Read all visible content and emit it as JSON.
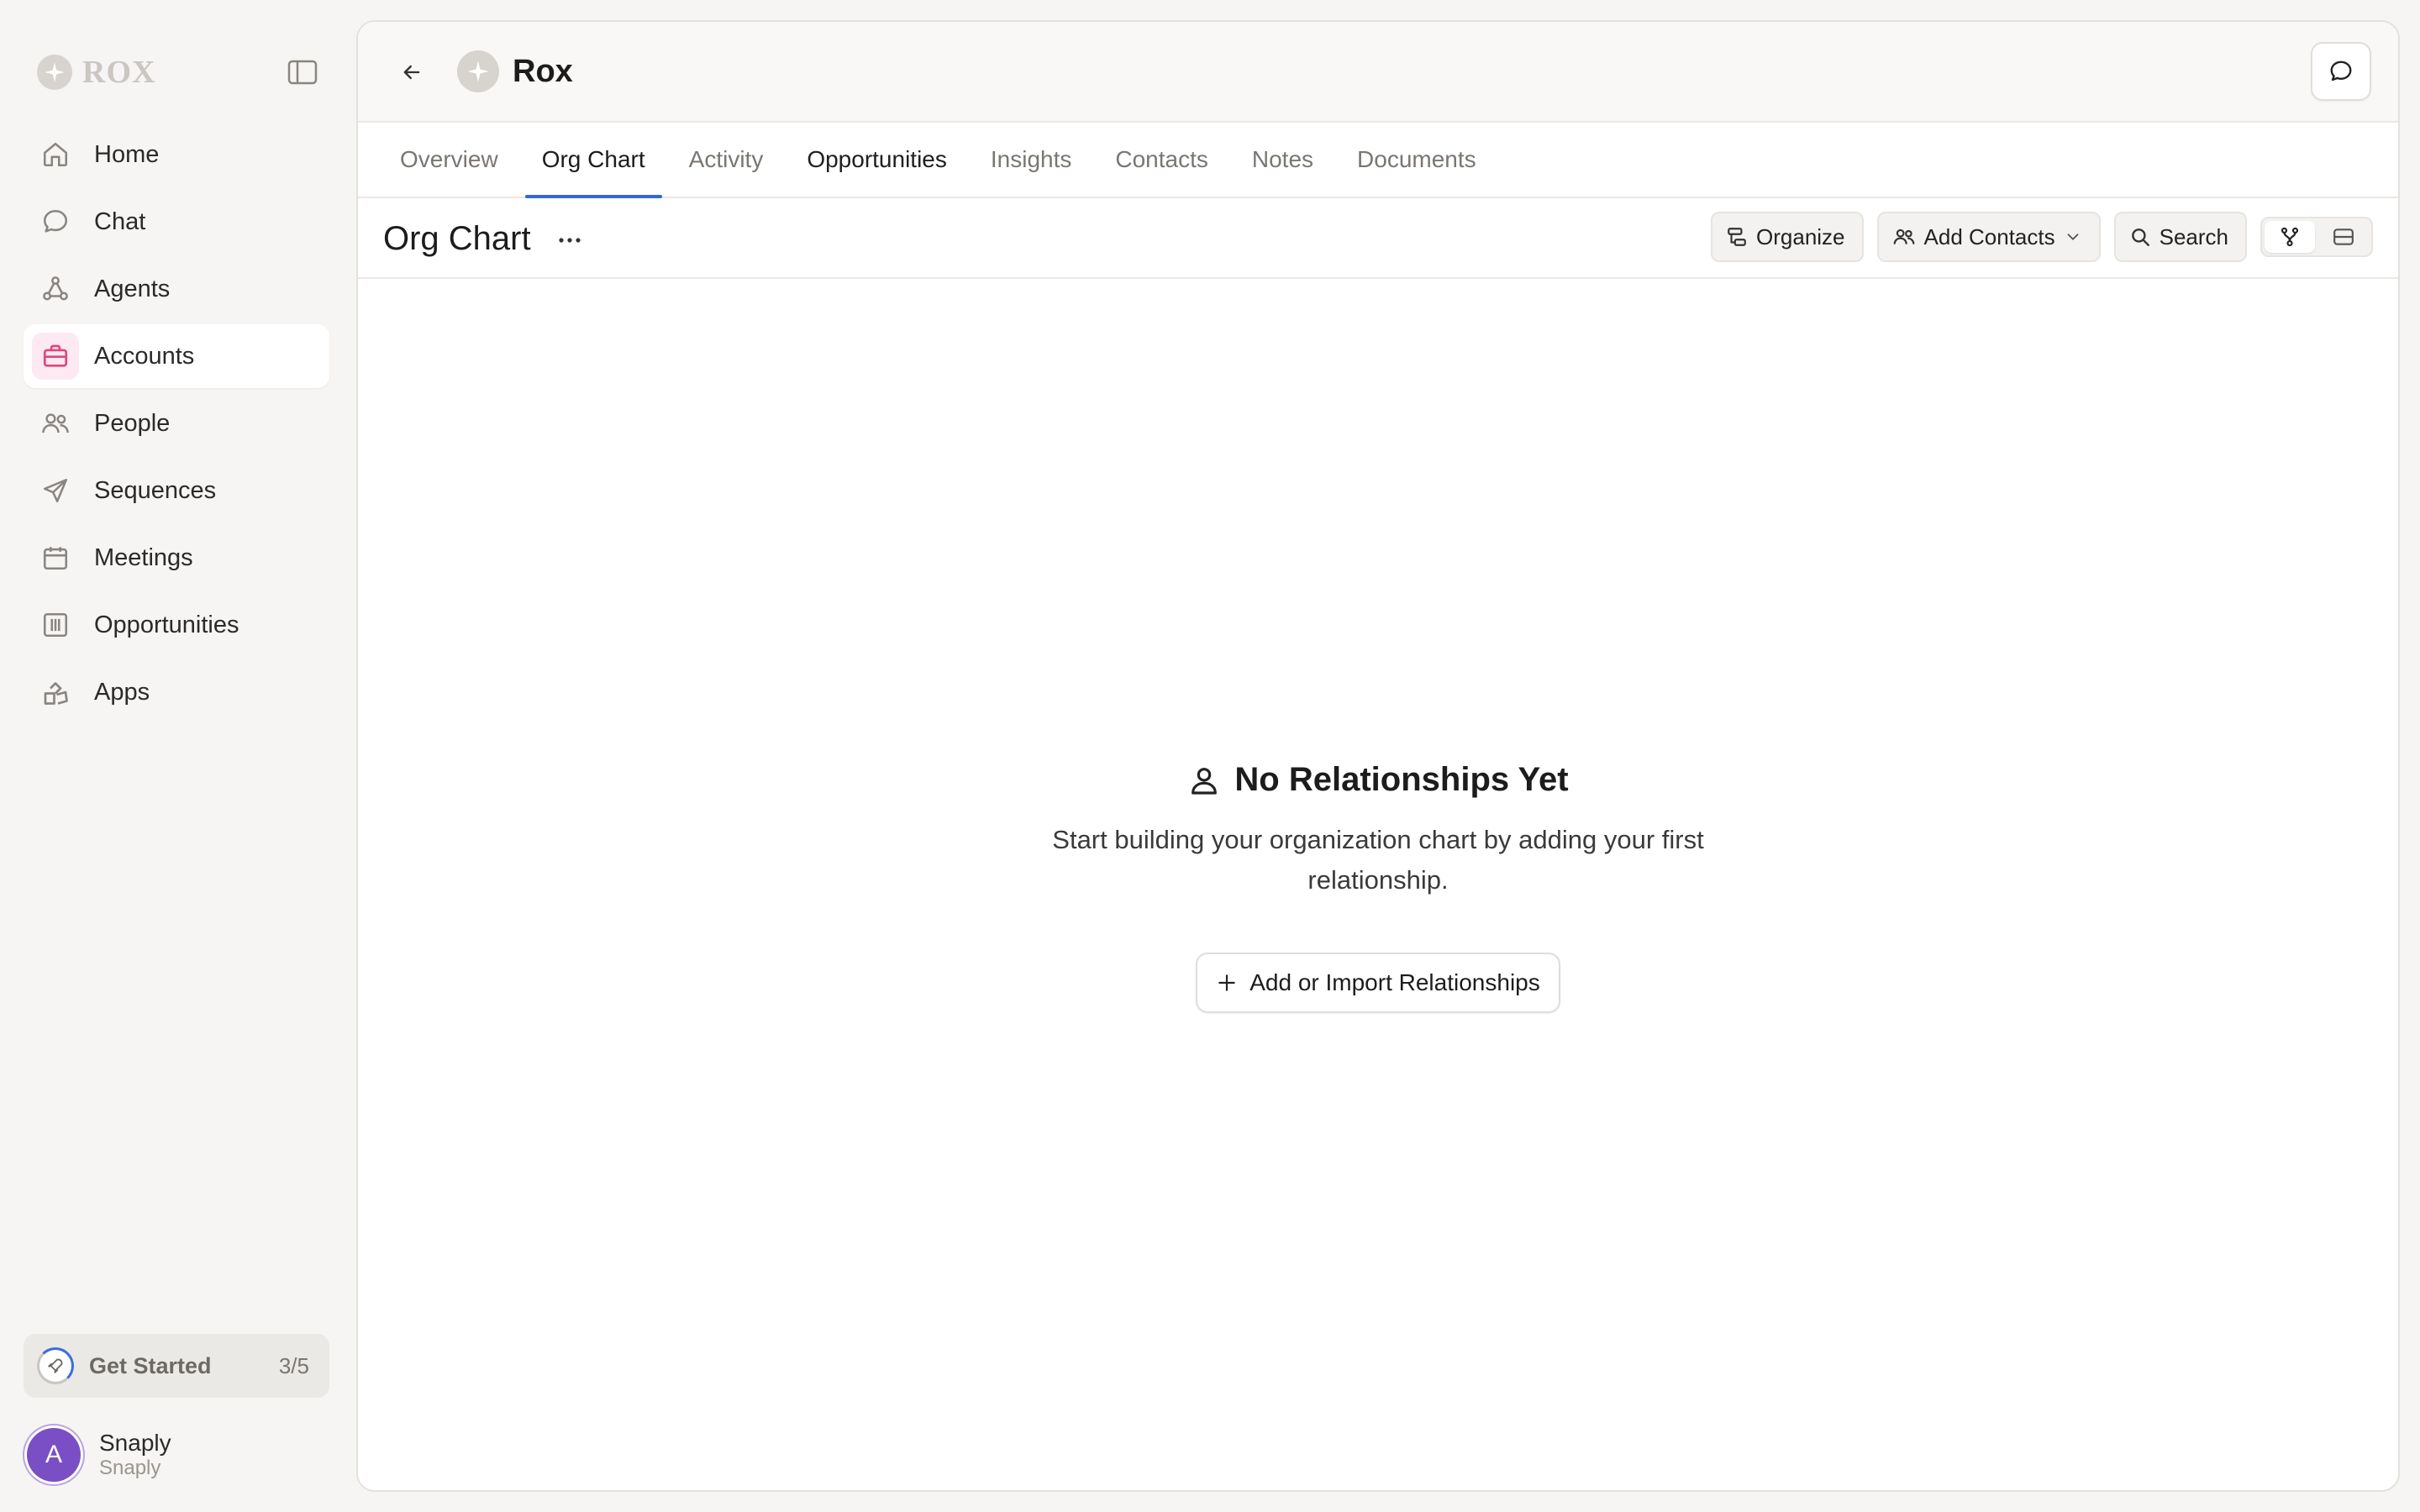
{
  "app": {
    "brand": "ROX"
  },
  "sidebar": {
    "items": [
      {
        "label": "Home",
        "icon": "home-icon"
      },
      {
        "label": "Chat",
        "icon": "chat-bubble-icon"
      },
      {
        "label": "Agents",
        "icon": "agents-icon"
      },
      {
        "label": "Accounts",
        "icon": "briefcase-icon",
        "active": true
      },
      {
        "label": "People",
        "icon": "people-icon"
      },
      {
        "label": "Sequences",
        "icon": "send-icon"
      },
      {
        "label": "Meetings",
        "icon": "calendar-icon"
      },
      {
        "label": "Opportunities",
        "icon": "columns-icon"
      },
      {
        "label": "Apps",
        "icon": "apps-icon"
      }
    ],
    "get_started": {
      "label": "Get Started",
      "progress": "3/5"
    },
    "user": {
      "initial": "A",
      "name": "Snaply",
      "org": "Snaply"
    }
  },
  "header": {
    "account_name": "Rox"
  },
  "tabs": [
    {
      "label": "Overview"
    },
    {
      "label": "Org Chart",
      "active": true
    },
    {
      "label": "Activity"
    },
    {
      "label": "Opportunities"
    },
    {
      "label": "Insights"
    },
    {
      "label": "Contacts"
    },
    {
      "label": "Notes"
    },
    {
      "label": "Documents"
    }
  ],
  "section": {
    "title": "Org Chart",
    "more": "···",
    "toolbar": {
      "organize": "Organize",
      "add_contacts": "Add Contacts",
      "search": "Search"
    }
  },
  "empty_state": {
    "title": "No Relationships Yet",
    "text": "Start building your organization chart by adding your first relationship.",
    "button": "Add or Import Relationships"
  },
  "colors": {
    "accent": "#2e6ad6",
    "active_nav_icon": "#e0457b",
    "avatar": "#7a4fc6"
  }
}
